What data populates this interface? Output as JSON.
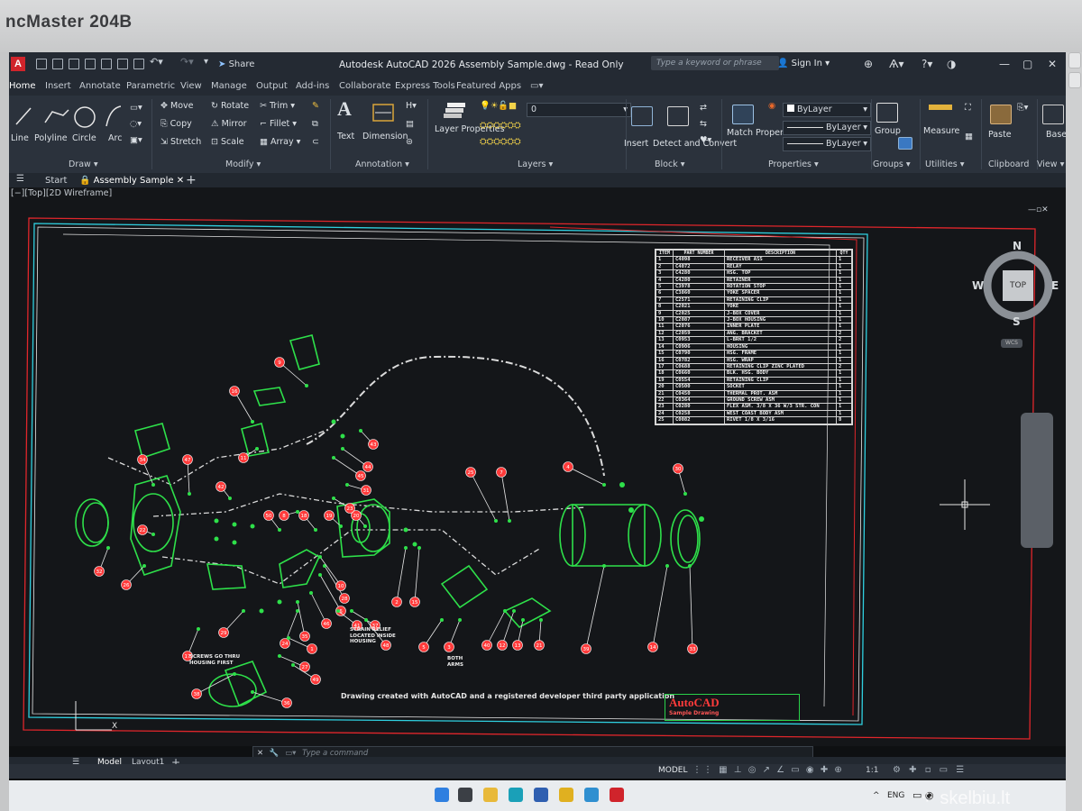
{
  "monitor": {
    "brand": "ncMaster 204B"
  },
  "app": {
    "logo": "A",
    "share_label": "Share",
    "title": "Autodesk AutoCAD 2026   Assembly Sample.dwg - Read Only",
    "search_placeholder": "Type a keyword or phrase",
    "sign_in": "Sign In"
  },
  "tabs": [
    "Home",
    "Insert",
    "Annotate",
    "Parametric",
    "View",
    "Manage",
    "Output",
    "Add-ins",
    "Collaborate",
    "Express Tools",
    "Featured Apps"
  ],
  "ribbon": {
    "draw": {
      "line": "Line",
      "polyline": "Polyline",
      "circle": "Circle",
      "arc": "Arc",
      "panel": "Draw"
    },
    "modify": {
      "move": "Move",
      "copy": "Copy",
      "stretch": "Stretch",
      "rotate": "Rotate",
      "mirror": "Mirror",
      "scale": "Scale",
      "trim": "Trim",
      "fillet": "Fillet",
      "array": "Array",
      "panel": "Modify"
    },
    "annotation": {
      "text": "Text",
      "dimension": "Dimension",
      "panel": "Annotation"
    },
    "layers": {
      "layer_properties": "Layer Properties",
      "current_layer": "0",
      "panel": "Layers"
    },
    "block": {
      "insert": "Insert",
      "detect": "Detect and Convert",
      "panel": "Block"
    },
    "properties": {
      "match": "Match Properties",
      "bylayer1": "ByLayer",
      "bylayer2": "ByLayer",
      "bylayer3": "ByLayer",
      "panel": "Properties"
    },
    "groups": {
      "group": "Group",
      "panel": "Groups"
    },
    "utilities": {
      "measure": "Measure",
      "panel": "Utilities"
    },
    "clipboard": {
      "paste": "Paste",
      "panel": "Clipboard"
    },
    "view": {
      "base": "Base",
      "panel": "View"
    }
  },
  "file_tabs": {
    "start": "Start",
    "current": "Assembly Sample"
  },
  "viewport_label": "[−][Top][2D Wireframe]",
  "bom": {
    "headers": [
      "ITEM",
      "PART NUMBER",
      "DESCRIPTION",
      "QTY"
    ],
    "rows": [
      [
        "1",
        "C4098",
        "RECEIVER ASS",
        "1"
      ],
      [
        "2",
        "C4072",
        "RELAY",
        "1"
      ],
      [
        "3",
        "C4280",
        "HSG. TOP",
        "1"
      ],
      [
        "4",
        "C4280",
        "RETAINER",
        "1"
      ],
      [
        "5",
        "C3978",
        "ROTATION STOP",
        "1"
      ],
      [
        "6",
        "C3860",
        "YOKE SPACER",
        "1"
      ],
      [
        "7",
        "C2571",
        "RETAINING CLIP",
        "1"
      ],
      [
        "8",
        "C2021",
        "YOKE",
        "1"
      ],
      [
        "9",
        "C2025",
        "J-BOX COVER",
        "1"
      ],
      [
        "10",
        "C2087",
        "J-BOX HOUSING",
        "1"
      ],
      [
        "11",
        "C2076",
        "INNER PLATE",
        "1"
      ],
      [
        "12",
        "C2059",
        "ANG. BRACKET",
        "2"
      ],
      [
        "13",
        "C0953",
        "L-BRKT 1/2",
        "2"
      ],
      [
        "14",
        "C0906",
        "HOUSING",
        "1"
      ],
      [
        "15",
        "C0790",
        "HSG. FRAME",
        "1"
      ],
      [
        "16",
        "C0782",
        "HSG. WRAP",
        "1"
      ],
      [
        "17",
        "C0688",
        "RETAINING CLIP ZINC PLATED",
        "2"
      ],
      [
        "18",
        "C0660",
        "BLK. HSG. BODY",
        "1"
      ],
      [
        "19",
        "C0554",
        "RETAINING CLIP",
        "1"
      ],
      [
        "20",
        "C0500",
        "SOCKET",
        "1"
      ],
      [
        "21",
        "C0450",
        "THERMAL PROT. ASM",
        "1"
      ],
      [
        "22",
        "C0364",
        "GROUND SCREW ASM",
        "1"
      ],
      [
        "23",
        "C0280",
        "FLEX ASM. 3/8 X 36 W/3 STR. CON",
        "1"
      ],
      [
        "24",
        "C0258",
        "WEST COAST BODY ASM",
        "1"
      ],
      [
        "25",
        "C0082",
        "RIVET 1/8 X 3/16",
        "8"
      ]
    ]
  },
  "callouts": [
    "9",
    "16",
    "34",
    "47",
    "11",
    "42",
    "22",
    "32",
    "26",
    "17",
    "29",
    "50",
    "8",
    "18",
    "19",
    "20",
    "43",
    "44",
    "45",
    "31",
    "23",
    "2",
    "15",
    "5",
    "3",
    "40",
    "12",
    "13",
    "21",
    "4",
    "30",
    "25",
    "7",
    "39",
    "14",
    "33",
    "24",
    "35",
    "46",
    "6",
    "28",
    "10",
    "38",
    "36",
    "27",
    "1",
    "41",
    "37",
    "48",
    "49"
  ],
  "notes": {
    "screws": "SCREWS GO THRU\nHOUSING FIRST",
    "strain": "STRAIN RELIEF\nLOCATED INSIDE\nHOUSING",
    "both_arms": "BOTH\nARMS"
  },
  "credit": "Drawing created with AutoCAD and a registered developer third party application",
  "title_block": {
    "brand": "AutoCAD",
    "subtitle": "Sample Drawing"
  },
  "viewcube": {
    "face": "TOP",
    "n": "N",
    "s": "S",
    "e": "E",
    "w": "W",
    "wcs": "WCS"
  },
  "command_placeholder": "Type a command",
  "layout_tabs": [
    "Model",
    "Layout1"
  ],
  "status": {
    "model": "MODEL",
    "scale": "1:1",
    "lang": "ENG"
  },
  "watermark": "skelbiu.lt",
  "colors": {
    "accent_green": "#2ee04a",
    "callout_red": "#ff3b3b",
    "cyan_border": "#2fd0e0",
    "red_border": "#e0262b"
  }
}
